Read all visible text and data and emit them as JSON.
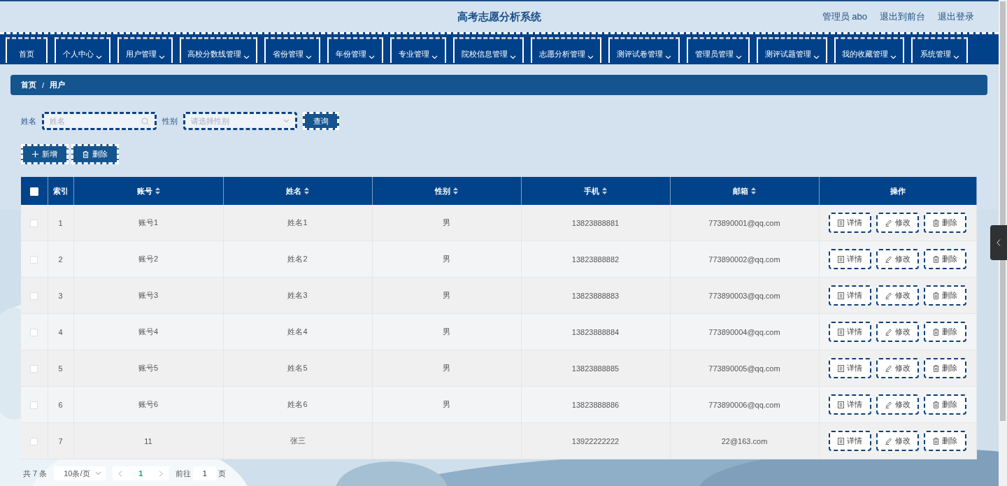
{
  "header": {
    "title": "高考志愿分析系统",
    "links": [
      "管理员 abo",
      "退出到前台",
      "退出登录"
    ]
  },
  "nav": [
    {
      "label": "首页",
      "dropdown": false
    },
    {
      "label": "个人中心",
      "dropdown": true
    },
    {
      "label": "用户管理",
      "dropdown": true
    },
    {
      "label": "高校分数线管理",
      "dropdown": true
    },
    {
      "label": "省份管理",
      "dropdown": true
    },
    {
      "label": "年份管理",
      "dropdown": true
    },
    {
      "label": "专业管理",
      "dropdown": true
    },
    {
      "label": "院校信息管理",
      "dropdown": true
    },
    {
      "label": "志愿分析管理",
      "dropdown": true
    },
    {
      "label": "测评试卷管理",
      "dropdown": true
    },
    {
      "label": "管理员管理",
      "dropdown": true
    },
    {
      "label": "测评试题管理",
      "dropdown": true
    },
    {
      "label": "我的收藏管理",
      "dropdown": true
    },
    {
      "label": "系统管理",
      "dropdown": true
    }
  ],
  "breadcrumb": {
    "items": [
      "首页",
      "用户"
    ],
    "separator": "/"
  },
  "search": {
    "fields": [
      {
        "kind": "input",
        "label": "姓名",
        "placeholder": "姓名"
      },
      {
        "kind": "select",
        "label": "性别",
        "placeholder": "请选择性别"
      }
    ],
    "button": "查询"
  },
  "actions": [
    {
      "kind": "add",
      "label": "新增"
    },
    {
      "kind": "delete",
      "label": "删除"
    }
  ],
  "table": {
    "select_all_checked": false,
    "columns": [
      {
        "label": "索引",
        "sortable": false
      },
      {
        "label": "账号",
        "sortable": true
      },
      {
        "label": "姓名",
        "sortable": true
      },
      {
        "label": "性别",
        "sortable": true
      },
      {
        "label": "手机",
        "sortable": true
      },
      {
        "label": "邮箱",
        "sortable": true
      },
      {
        "label": "操作",
        "sortable": false
      }
    ],
    "rows": [
      {
        "checked": false,
        "index": "1",
        "account": "账号1",
        "name": "姓名1",
        "gender": "男",
        "phone": "13823888881",
        "email": "773890001@qq.com",
        "actions": [
          {
            "kind": "detail",
            "label": "详情"
          },
          {
            "kind": "edit",
            "label": "修改"
          },
          {
            "kind": "delete",
            "label": "删除"
          }
        ]
      },
      {
        "checked": false,
        "index": "2",
        "account": "账号2",
        "name": "姓名2",
        "gender": "男",
        "phone": "13823888882",
        "email": "773890002@qq.com",
        "actions": [
          {
            "kind": "detail",
            "label": "详情"
          },
          {
            "kind": "edit",
            "label": "修改"
          },
          {
            "kind": "delete",
            "label": "删除"
          }
        ]
      },
      {
        "checked": false,
        "index": "3",
        "account": "账号3",
        "name": "姓名3",
        "gender": "男",
        "phone": "13823888883",
        "email": "773890003@qq.com",
        "actions": [
          {
            "kind": "detail",
            "label": "详情"
          },
          {
            "kind": "edit",
            "label": "修改"
          },
          {
            "kind": "delete",
            "label": "删除"
          }
        ]
      },
      {
        "checked": false,
        "index": "4",
        "account": "账号4",
        "name": "姓名4",
        "gender": "男",
        "phone": "13823888884",
        "email": "773890004@qq.com",
        "actions": [
          {
            "kind": "detail",
            "label": "详情"
          },
          {
            "kind": "edit",
            "label": "修改"
          },
          {
            "kind": "delete",
            "label": "删除"
          }
        ]
      },
      {
        "checked": false,
        "index": "5",
        "account": "账号5",
        "name": "姓名5",
        "gender": "男",
        "phone": "13823888885",
        "email": "773890005@qq.com",
        "actions": [
          {
            "kind": "detail",
            "label": "详情"
          },
          {
            "kind": "edit",
            "label": "修改"
          },
          {
            "kind": "delete",
            "label": "删除"
          }
        ]
      },
      {
        "checked": false,
        "index": "6",
        "account": "账号6",
        "name": "姓名6",
        "gender": "男",
        "phone": "13823888886",
        "email": "773890006@qq.com",
        "actions": [
          {
            "kind": "detail",
            "label": "详情"
          },
          {
            "kind": "edit",
            "label": "修改"
          },
          {
            "kind": "delete",
            "label": "删除"
          }
        ]
      },
      {
        "checked": false,
        "index": "7",
        "account": "11",
        "name": "张三",
        "phone": "13922222222",
        "email": "22@163.com",
        "actions": [
          {
            "kind": "detail",
            "label": "详情"
          },
          {
            "kind": "edit",
            "label": "修改"
          },
          {
            "kind": "delete",
            "label": "删除"
          }
        ]
      }
    ]
  },
  "pagination": {
    "total": "共 7 条",
    "page_size": "10条/页",
    "pages": [
      {
        "label": "1",
        "selected": true
      }
    ],
    "goto_label": "前往",
    "goto_value": "1",
    "goto_suffix": "页"
  }
}
